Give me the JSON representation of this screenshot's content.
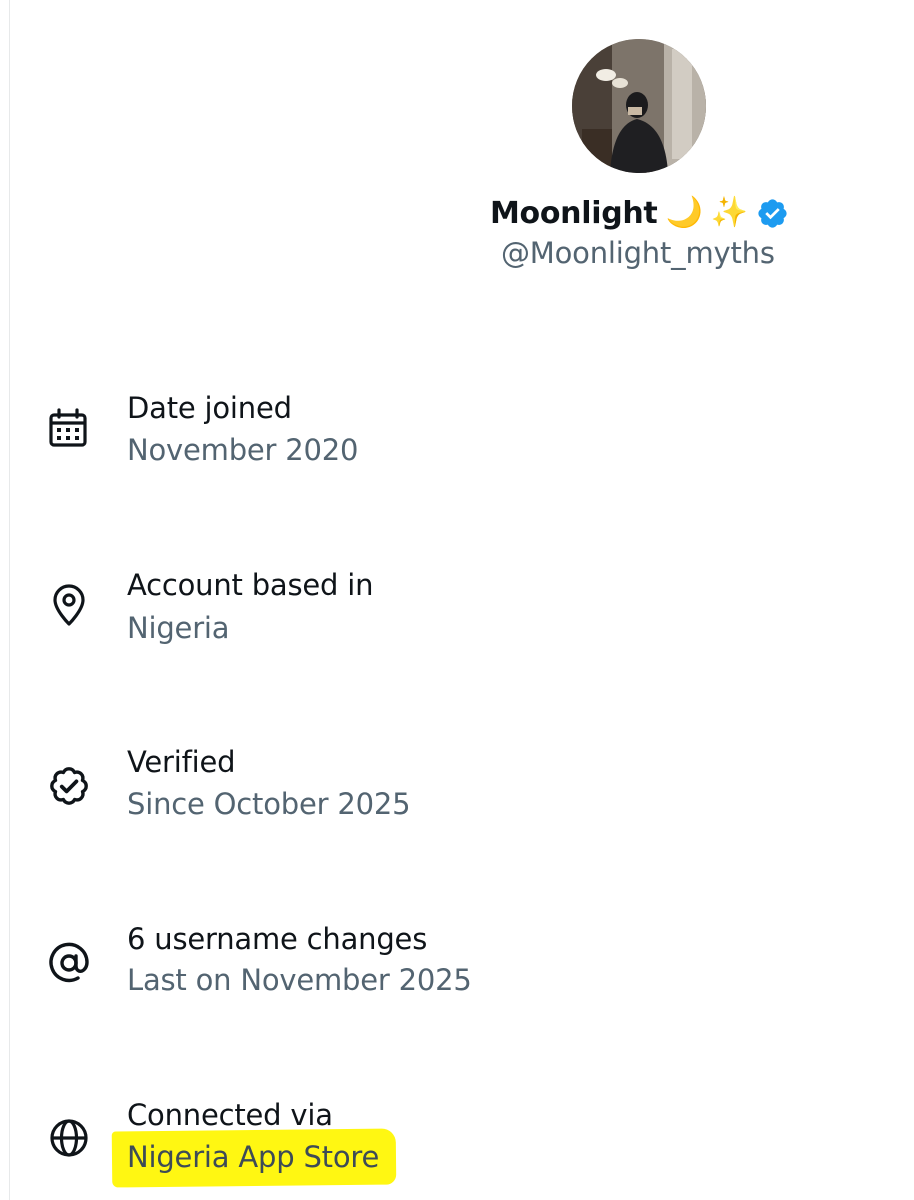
{
  "profile": {
    "display_name": "Moonlight",
    "name_emojis": [
      "🌙",
      "✨"
    ],
    "handle": "@Moonlight_myths",
    "verified": true,
    "verified_badge_color": "#1d9bf0"
  },
  "about": {
    "items": [
      {
        "icon": "calendar-icon",
        "title": "Date joined",
        "value": "November 2020"
      },
      {
        "icon": "location-pin-icon",
        "title": "Account based in",
        "value": "Nigeria"
      },
      {
        "icon": "verified-check-icon",
        "title": "Verified",
        "value": "Since October 2025"
      },
      {
        "icon": "at-sign-icon",
        "title": "6 username changes",
        "value": "Last on November 2025"
      },
      {
        "icon": "globe-icon",
        "title": "Connected via",
        "value": "Nigeria App Store",
        "highlighted": true
      }
    ]
  },
  "colors": {
    "primary_text": "#0f1419",
    "secondary_text": "#536471",
    "highlight": "#fff712",
    "verified_blue": "#1d9bf0"
  }
}
